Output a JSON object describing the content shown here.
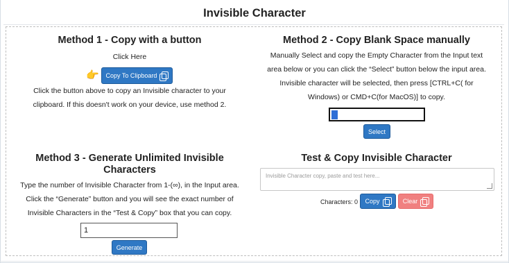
{
  "page": {
    "title": "Invisible Character"
  },
  "method1": {
    "heading": "Method 1 - Copy with a button",
    "click_here": "Click Here",
    "copy_button_label": "Copy To Clipboard",
    "description_line1": "Click the button above to copy an Invisible character to your",
    "description_line2": "clipboard. If this doesn't work on your device, use method 2.",
    "pointer_icon": "pointing-hand-icon"
  },
  "method2": {
    "heading": "Method 2 - Copy Blank Space manually",
    "description_line1": "Manually Select and copy the Empty Character from the Input text",
    "description_line2": "area below or you can click the “Select” button below the input area.",
    "description_line3": "Invisible character will be selected, then press [CTRL+C( for",
    "description_line4": "Windows) or CMD+C(for MacOS)] to copy.",
    "input_value": "",
    "select_button_label": "Select"
  },
  "method3": {
    "heading_line1": "Method 3 - Generate Unlimited Invisible",
    "heading_line2": "Characters",
    "description_line1": "Type the number of Invisible Character from 1-(∞), in the Input area.",
    "description_line2": "Click the “Generate” button and you will see the exact number of",
    "description_line3": "Invisible Characters in the “Test & Copy” box that you can copy.",
    "count_input_value": "1",
    "generate_button_label": "Generate"
  },
  "test_copy": {
    "heading": "Test & Copy Invisible Character",
    "textarea_placeholder": "Invisible Character copy, paste and test here...",
    "characters_label": "Characters: 0",
    "copy_button_label": "Copy",
    "clear_button_label": "Clear"
  },
  "colors": {
    "primary_button": "#2f78c4",
    "clear_button": "#f08080",
    "caret_highlight": "#2f6fd6"
  }
}
